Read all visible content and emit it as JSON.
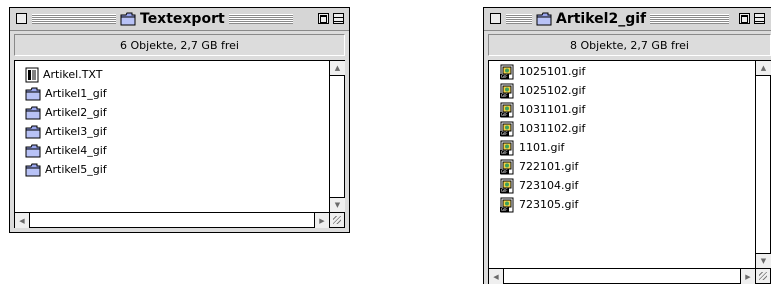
{
  "windows": [
    {
      "title": "Textexport",
      "status": "6 Objekte, 2,7 GB frei",
      "items": [
        {
          "name": "Artikel.TXT",
          "icon": "text-document-icon"
        },
        {
          "name": "Artikel1_gif",
          "icon": "folder-icon"
        },
        {
          "name": "Artikel2_gif",
          "icon": "folder-icon"
        },
        {
          "name": "Artikel3_gif",
          "icon": "folder-icon"
        },
        {
          "name": "Artikel4_gif",
          "icon": "folder-icon"
        },
        {
          "name": "Artikel5_gif",
          "icon": "folder-icon"
        }
      ]
    },
    {
      "title": "Artikel2_gif",
      "status": "8 Objekte, 2,7 GB frei",
      "items": [
        {
          "name": "1025101.gif",
          "icon": "gif-image-icon"
        },
        {
          "name": "1025102.gif",
          "icon": "gif-image-icon"
        },
        {
          "name": "1031101.gif",
          "icon": "gif-image-icon"
        },
        {
          "name": "1031102.gif",
          "icon": "gif-image-icon"
        },
        {
          "name": "1101.gif",
          "icon": "gif-image-icon"
        },
        {
          "name": "722101.gif",
          "icon": "gif-image-icon"
        },
        {
          "name": "723104.gif",
          "icon": "gif-image-icon"
        },
        {
          "name": "723105.gif",
          "icon": "gif-image-icon"
        }
      ]
    }
  ],
  "colors": {
    "window_bg": "#dcdcdc",
    "folder_blue": "#9aa6ee",
    "gif_icon_yellow": "#f2d24a"
  }
}
